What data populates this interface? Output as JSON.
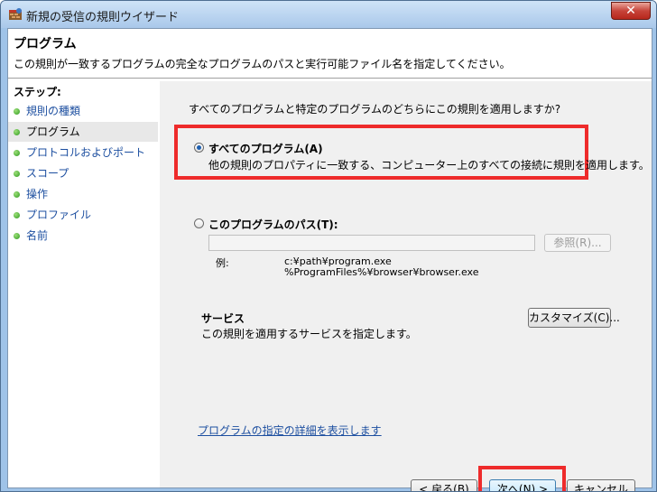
{
  "window": {
    "title": "新規の受信の規則ウイザード",
    "close_glyph": "✕"
  },
  "header": {
    "title": "プログラム",
    "description": "この規則が一致するプログラムの完全なプログラムのパスと実行可能ファイル名を指定してください。"
  },
  "sidebar": {
    "steps_label": "ステップ:",
    "items": [
      {
        "label": "規則の種類",
        "current": false
      },
      {
        "label": "プログラム",
        "current": true
      },
      {
        "label": "プロトコルおよびポート",
        "current": false
      },
      {
        "label": "スコープ",
        "current": false
      },
      {
        "label": "操作",
        "current": false
      },
      {
        "label": "プロファイル",
        "current": false
      },
      {
        "label": "名前",
        "current": false
      }
    ]
  },
  "main": {
    "question": "すべてのプログラムと特定のプログラムのどちらにこの規則を適用しますか?",
    "all_programs": {
      "label": "すべてのプログラム(A)",
      "description": "他の規則のプロパティに一致する、コンピューター上のすべての接続に規則を適用します。",
      "checked": true
    },
    "program_path": {
      "label": "このプログラムのパス(T):",
      "value": "",
      "checked": false,
      "browse_label": "参照(R)...",
      "example_label": "例:",
      "example_line1": "c:¥path¥program.exe",
      "example_line2": "%ProgramFiles%¥browser¥browser.exe"
    },
    "services": {
      "title": "サービス",
      "description": "この規則を適用するサービスを指定します。",
      "customize_label": "カスタマイズ(C)..."
    },
    "details_link": "プログラムの指定の詳細を表示します"
  },
  "footer": {
    "back_label": "< 戻る(B)",
    "next_label": "次へ(N) >",
    "cancel_label": "キャンセル"
  },
  "colors": {
    "highlight": "#ee2b2b",
    "link": "#1d4fa0",
    "titlebar": "#a9c8ea"
  }
}
